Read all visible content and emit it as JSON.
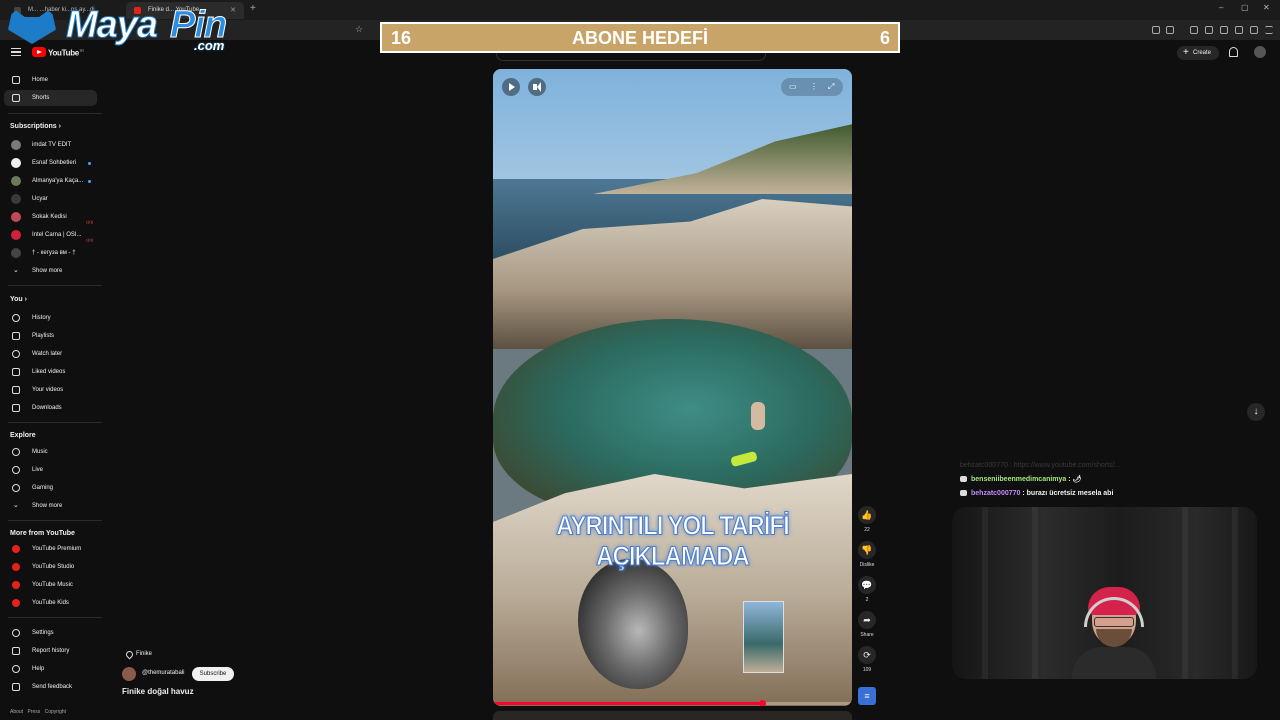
{
  "browser": {
    "tabs": [
      {
        "label": "M... ...haber ki...ns ay...di"
      },
      {
        "label": "Finike d... YouTube"
      }
    ],
    "new_tab": "+",
    "window_controls": [
      "–",
      "▢",
      "✕"
    ]
  },
  "overlay_logo": {
    "maya": "Maya",
    "pin": "Pin",
    "com": ".com"
  },
  "youtube": {
    "logo_text": "YouTube",
    "logo_country": "TR",
    "create_label": "Create"
  },
  "sidebar": {
    "main": [
      {
        "label": "Home"
      },
      {
        "label": "Shorts"
      }
    ],
    "subscriptions_heading": "Subscriptions",
    "subscriptions": [
      {
        "label": "imdat TV EDIT",
        "color": "#7a7a7a"
      },
      {
        "label": "Esnaf Sohbetleri",
        "color": "#f0f0f0"
      },
      {
        "label": "Almanya'ya Kaça...",
        "color": "#6b7a5a"
      },
      {
        "label": "Ucyar",
        "color": "#3a3a3a"
      },
      {
        "label": "Sokak Kedisi",
        "color": "#c04a5a"
      },
      {
        "label": "Intel Carna | OSI...",
        "color": "#d0203a"
      },
      {
        "label": "† - кегуза вм - †",
        "color": "#444444"
      }
    ],
    "sub_show_more": "Show more",
    "you_heading": "You",
    "you_items": [
      {
        "label": "History"
      },
      {
        "label": "Playlists"
      },
      {
        "label": "Watch later"
      },
      {
        "label": "Liked videos"
      },
      {
        "label": "Your videos"
      },
      {
        "label": "Downloads"
      }
    ],
    "explore_heading": "Explore",
    "explore_items": [
      {
        "label": "Music"
      },
      {
        "label": "Live"
      },
      {
        "label": "Gaming"
      },
      {
        "label": "Show more"
      }
    ],
    "more_heading": "More from YouTube",
    "more_items": [
      {
        "label": "YouTube Premium"
      },
      {
        "label": "YouTube Studio"
      },
      {
        "label": "YouTube Music"
      },
      {
        "label": "YouTube Kids"
      }
    ],
    "settings_items": [
      {
        "label": "Settings"
      },
      {
        "label": "Report history"
      },
      {
        "label": "Help"
      },
      {
        "label": "Send feedback"
      }
    ],
    "footer": "About Press Copyright"
  },
  "short": {
    "overlay_text": "AYRINTILI YOL TARİFİ AÇIKLAMADA",
    "location": "Finike",
    "channel": "@themuratabali",
    "subscribe_label": "Subscribe",
    "title": "Finike doğal havuz",
    "progress": 0.75
  },
  "actions": [
    {
      "icon": "👍",
      "label": "22"
    },
    {
      "icon": "👎",
      "label": "Dislike"
    },
    {
      "icon": "💬",
      "label": "2"
    },
    {
      "icon": "➦",
      "label": "Share"
    },
    {
      "icon": "⟳",
      "label": "109"
    }
  ],
  "goal": {
    "left": "16",
    "center": "ABONE HEDEFİ",
    "right": "6"
  },
  "chat": [
    {
      "user": "benseniibeenmedimcanimya",
      "text": " : ",
      "emote": "🌶",
      "user_color": "#a8e37e"
    },
    {
      "user": "behzatc000770",
      "text": " : burazı ücretsiz mesela abi",
      "user_color": "#c58bff"
    }
  ],
  "chat_faint": "behzatc000770 : https://www.youtube.com/shorts/..."
}
